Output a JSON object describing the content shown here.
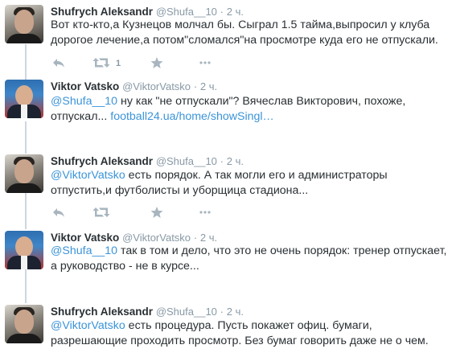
{
  "colors": {
    "link": "#3b94d9",
    "meta": "#8899a6",
    "text": "#292f33",
    "icon": "#a8b5bf",
    "connector": "#ccd6dd"
  },
  "tweets": [
    {
      "name": "Shufrych Aleksandr",
      "handle": "@Shufa__10",
      "dot": "·",
      "time": "2 ч.",
      "avatar_icon": "avatar-shufrych",
      "parts": [
        {
          "type": "text",
          "value": "Вот кто-кто,а Кузнецов молчал бы. Сыграл 1.5 тайма,выпросил у клуба дорогое лечение,а потом\"сломался\"на просмотре куда его не отпускали."
        }
      ],
      "retweet_count": "1"
    },
    {
      "name": "Viktor Vatsko",
      "handle": "@ViktorVatsko",
      "dot": "·",
      "time": "2 ч.",
      "avatar_icon": "avatar-vatsko",
      "parts": [
        {
          "type": "mention",
          "value": "@Shufa__10"
        },
        {
          "type": "text",
          "value": " ну как \"не отпускали\"? Вячеслав Викторович, похоже, отпускал... "
        },
        {
          "type": "link",
          "value": "football24.ua/home/showSingl…"
        }
      ],
      "retweet_count": ""
    },
    {
      "name": "Shufrych Aleksandr",
      "handle": "@Shufa__10",
      "dot": "·",
      "time": "2 ч.",
      "avatar_icon": "avatar-shufrych",
      "parts": [
        {
          "type": "mention",
          "value": "@ViktorVatsko"
        },
        {
          "type": "text",
          "value": " есть порядок. А так могли его и администраторы отпустить,и футболисты и уборщица стадиона..."
        }
      ],
      "retweet_count": ""
    },
    {
      "name": "Viktor Vatsko",
      "handle": "@ViktorVatsko",
      "dot": "·",
      "time": "2 ч.",
      "avatar_icon": "avatar-vatsko",
      "parts": [
        {
          "type": "mention",
          "value": "@Shufa__10"
        },
        {
          "type": "text",
          "value": " так в том и дело, что это не очень порядок: тренер отпускает, а руководство - не в курсе..."
        }
      ],
      "retweet_count": ""
    },
    {
      "name": "Shufrych Aleksandr",
      "handle": "@Shufa__10",
      "dot": "·",
      "time": "2 ч.",
      "avatar_icon": "avatar-shufrych",
      "parts": [
        {
          "type": "mention",
          "value": "@ViktorVatsko"
        },
        {
          "type": "text",
          "value": " есть процедура. Пусть покажет офиц. бумаги, разрешающие  проходить просмотр. Без бумаг говорить даже не о чем."
        }
      ],
      "retweet_count": ""
    }
  ]
}
